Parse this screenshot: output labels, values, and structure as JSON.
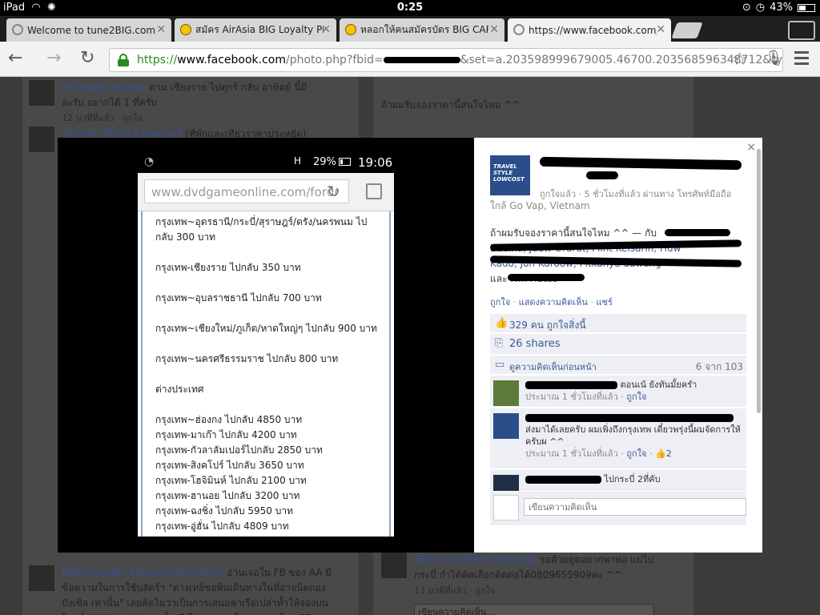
{
  "status_bar": {
    "device": "iPad",
    "time": "0:25",
    "battery": "43%",
    "battery_level": 0.43
  },
  "tabs": [
    {
      "title": "Welcome to tune2BIG.com",
      "active": false,
      "icon": "globe-icon"
    },
    {
      "title": "สมัคร AirAsia BIG Loyalty Pr",
      "active": false,
      "icon": "smiley-icon"
    },
    {
      "title": "หลอกให้คนสมัครบัตร BIG CARD",
      "active": false,
      "icon": "smiley-icon"
    },
    {
      "title": "https://www.facebook.com/p",
      "active": true,
      "icon": "globe-icon"
    }
  ],
  "omnibox": {
    "scheme": "https://",
    "host": "www.facebook.com",
    "path_start": "/photo.php?fbid=",
    "path_end": "&set=a.203598999679005.46700.203568596348712&ty"
  },
  "background_page": {
    "left_items": [
      {
        "name": "Manake Isume",
        "text": "ตาม เชียงราย ไปตุกร์ กลับ อาทิตย์ นี้มีอะรับ อยากได้ 1 ที่ครับ",
        "meta": "12 นาทีที่แล้ว · ถูกใจ"
      },
      {
        "name": "Travel Style Lowcost",
        "text": "(ที่พักและเที่ยวราคาประหยัด) ลมพายุนุ",
        "meta": ""
      },
      {
        "name": "Natchanon Theerawarodom",
        "text": "อ่านเจอใน FB ของ AA มีข้อความในการใช้บลัตร้า \"ต่างเทย็ขอพ้นเดินทางในที่อาจนิตถองปังเซิล เท่านั้น\" เลยคิดไม่ว่าเป็นการเสนอค่าเรือเปล่าท้ำให้จองบนโพสก์ AK (Airasia) เท่านั้น จึงไม่รอมยามโดวงวรงะ โพส FD (Thai",
        "meta": ""
      }
    ],
    "right_items": [
      {
        "name": "",
        "text": "ถ้าผมรับจองราคานี้สนใจไหม ^^",
        "meta": ""
      },
      {
        "name": "Black Coffee Original",
        "text": "รอค้วยตูดอยากพาพ่อ แม่ไปกระบี่ กำได้ติดเลือกติดต่อได้0809655909ค่ะ ^^",
        "meta": "13 นาทีที่แล้ว · ถูกใจ"
      }
    ],
    "input_placeholder": "เขียนความคิดเห็น..."
  },
  "phone_screenshot": {
    "signal": "H",
    "battery": "29%",
    "battery_level": 0.29,
    "time": "19:06",
    "url_host": "www.dvdgameonline.com",
    "url_rest": "/forur",
    "lines": [
      "กรุงเทพ~อุดรธานี/กระบี่/สุราษฎร์/ตรัง/นครพนม ไป",
      "กลับ 300 บาท",
      "",
      "กรุงเทพ-เชียงราย ไปกลับ 350 บาท",
      "",
      "กรุงเทพ~อุบลราชธานี ไปกลับ 700 บาท",
      "",
      "กรุงเทพ~เชียงใหม่/ภูเก็ต/หาดใหญ่ๆ ไปกลับ 900 บาท",
      "",
      "กรุงเทพ~นครศรีธรรมราช ไปกลับ 800 บาท",
      "",
      "ต่างประเทศ",
      "",
      "กรุงเทพ~ฮ่องกง ไปกลับ 4850 บาท",
      "กรุงเทพ-มาเก๊า ไปกลับ 4200 บาท",
      "กรุงเทพ-กัวลาลัมเปอร์ไปกลับ 2850 บาท",
      "กรุงเทพ-สิงคโปร์ ไปกลับ 3650 บาท",
      "กรุงเทพ-โฮจิมินห์ ไปกลับ 2100 บาท",
      "กรุงเทพ-ฮานอย ไปกลับ 3200 บาท",
      "กรุงเทพ-ฉงชิ่ง ไปกลับ 5950 บาท",
      "กรุงเทพ-อู่ฮั่น ไปกลับ 4809 บาท"
    ]
  },
  "side_panel": {
    "close": "×",
    "page_logo": "TRAVEL STYLE LOWCOST",
    "meta_line": "ถูกใจแล้ว · 5 ชั่วโมงที่แล้ว ผ่านทาง โทรศัพท์มือถือ",
    "location": "ใกล้ Go Vap, Vietnam",
    "caption": "ถ้าผมรับจองราคานี้สนใจไหม ^^ — กับ",
    "tagged_1": "Baeina, Jaew Orarat, Flint Kelsarin, Huw",
    "tagged_2": "Kado, Jon Kuroow, Pitkanya Sawang",
    "tagged_and": "และ",
    "tagged_3": "N... Hatus",
    "actions": [
      "ถูกใจ",
      "แสดงความคิดเห็น",
      "แชร์"
    ],
    "likes": "329 คน ถูกใจสิ่งนี้",
    "shares": "26 shares",
    "prev_comments": "ดูความคิดเห็นก่อนหน้า",
    "comment_count": "6 จาก 103",
    "comments": [
      {
        "text": "ตอนเน้ ยังทันมั้ยครำ",
        "meta": "ประมาณ 1 ชั่วโมงที่แล้ว",
        "like": "ถูกใจ",
        "likes": ""
      },
      {
        "text": "ส่งมาได้เลยครับ ผมเพิ่งถึงกรุงเทพ เดี๋ยวพรุ่งนี้ผมจัดการให้ ครับผ ^^",
        "meta": "ประมาณ 1 ชั่วโมงที่แล้ว",
        "like": "ถูกใจ",
        "likes": "2"
      },
      {
        "text": "ไปกระบี่ 2ที่คับ",
        "meta": "",
        "like": "",
        "likes": ""
      }
    ],
    "comment_placeholder": "เขียนความคิดเห็น"
  },
  "colors": {
    "fb_blue": "#3b5998",
    "ssl_green": "#2a8a1e",
    "overlay": "#000000"
  }
}
